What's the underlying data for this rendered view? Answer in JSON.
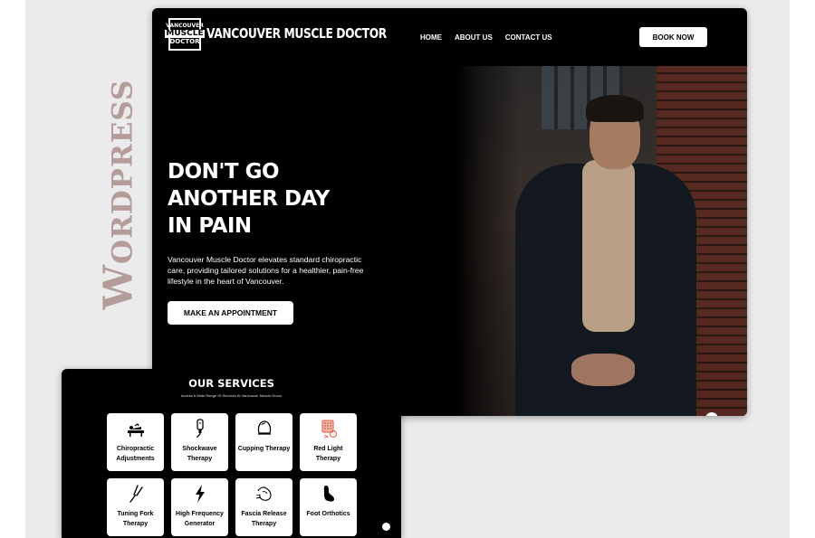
{
  "side_label": "Wordpress",
  "site": {
    "logo_lines": [
      "VANCOUVER",
      "MUSCLE",
      "DOCTOR"
    ],
    "brand": "VANCOUVER MUSCLE DOCTOR",
    "nav": [
      "HOME",
      "ABOUT US",
      "CONTACT US"
    ],
    "book_button": "BOOK NOW",
    "headline_lines": [
      "DON'T GO",
      "ANOTHER DAY",
      "IN PAIN"
    ],
    "tagline": "Vancouver Muscle Doctor elevates standard chiropractic care, providing tailored solutions for a healthier, pain-free lifestyle in the heart of Vancouver.",
    "cta_button": "MAKE AN APPOINTMENT"
  },
  "services": {
    "title": "OUR SERVICES",
    "subtitle": "Access A Wide Range Of Services At Vancouver Muscle Docor",
    "items": [
      {
        "label": "Chiropractic Adjustments",
        "icon": "chiropractic-table-icon"
      },
      {
        "label": "Shockwave Therapy",
        "icon": "shockwave-device-icon"
      },
      {
        "label": "Cupping Therapy",
        "icon": "cupping-cup-icon"
      },
      {
        "label": "Red Light Therapy",
        "icon": "red-light-panel-icon"
      },
      {
        "label": "Tuning Fork Therapy",
        "icon": "tuning-fork-icon"
      },
      {
        "label": "High Frequency Generator",
        "icon": "lightning-bolt-icon"
      },
      {
        "label": "Fascia Release Therapy",
        "icon": "fascia-release-icon"
      },
      {
        "label": "Foot Orthotics",
        "icon": "foot-orthotic-icon"
      }
    ]
  }
}
